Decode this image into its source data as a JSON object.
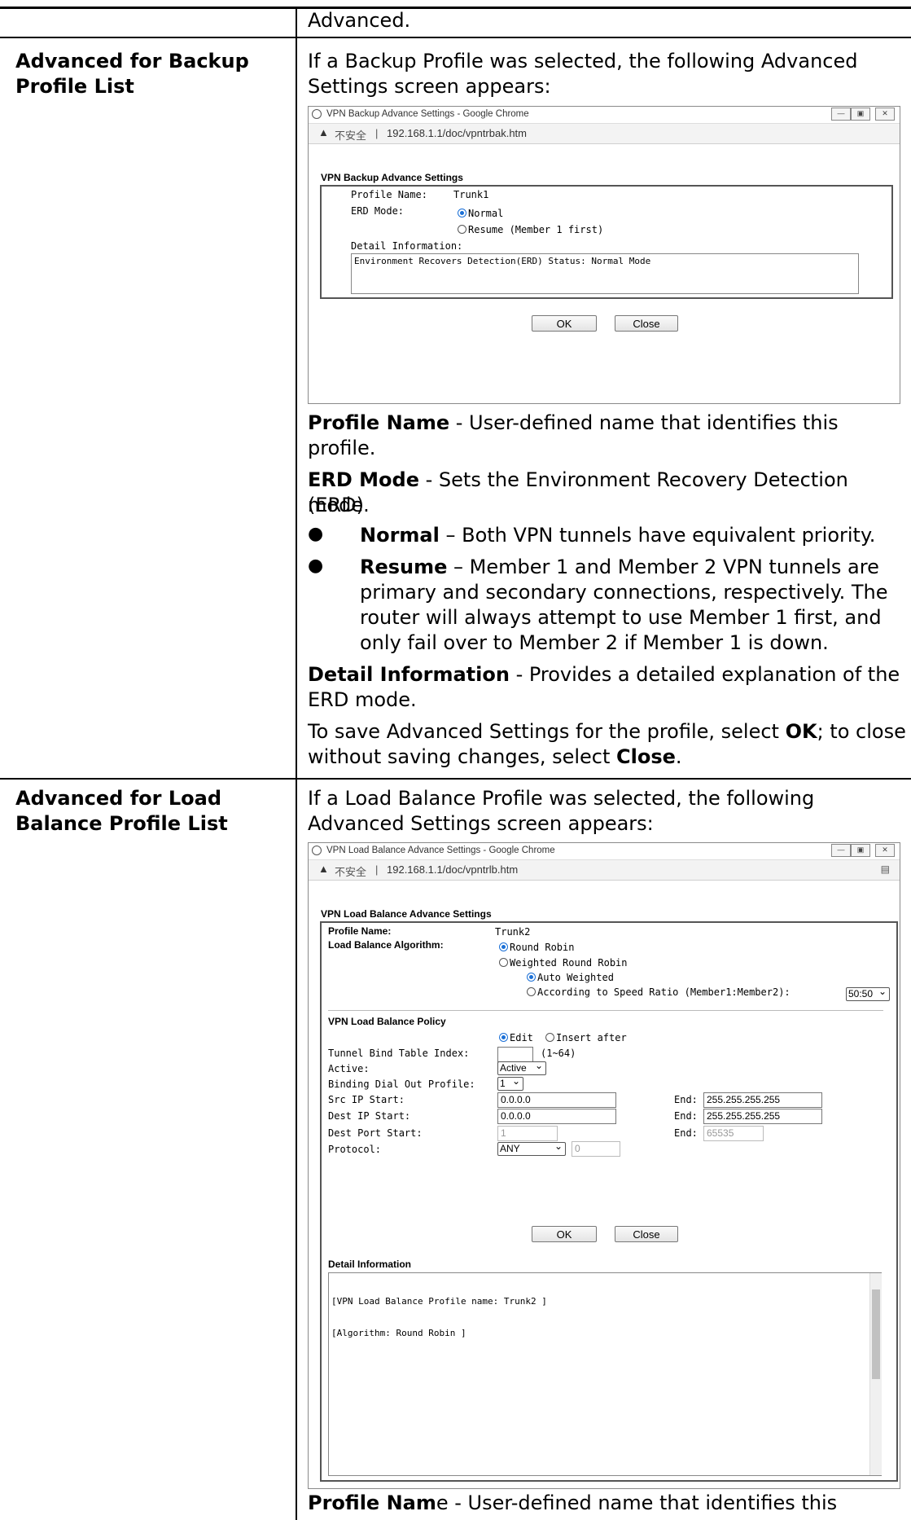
{
  "rows": {
    "top_text": "Advanced.",
    "backup": {
      "label_line1": "Advanced for Backup",
      "label_line2": "Profile List",
      "intro_line1": "If a Backup Profile was selected, the following Advanced",
      "intro_line2": "Settings screen appears:",
      "profile_name_term": "Profile Name",
      "profile_name_desc1": " - User-defined name that identifies this",
      "profile_name_desc2": "profile.",
      "erd_term": "ERD Mode",
      "erd_desc1": " - Sets the Environment Recovery Detection (ERD)",
      "erd_desc2": "mode.",
      "bullet_normal_term": "Normal",
      "bullet_normal_desc": " – Both VPN tunnels have equivalent priority.",
      "bullet_resume_term": "Resume",
      "bullet_resume_desc1": " – Member 1 and Member 2 VPN tunnels are",
      "bullet_resume_desc2": "primary and secondary connections, respectively. The",
      "bullet_resume_desc3": "router will always attempt to use Member 1 first, and",
      "bullet_resume_desc4": "only fail over to Member 2 if Member 1 is down.",
      "detail_term": "Detail Information",
      "detail_desc1": " - Provides a detailed explanation of the",
      "detail_desc2": "ERD mode.",
      "save_line1_a": "To save Advanced Settings for the profile, select ",
      "save_ok": "OK",
      "save_line1_b": "; to close",
      "save_line2_a": "without saving changes, select ",
      "save_close": "Close",
      "save_line2_b": "."
    },
    "lb": {
      "label_line1": "Advanced for Load",
      "label_line2": "Balance Profile List",
      "intro_line1": "If a Load Balance Profile was selected, the following",
      "intro_line2": "Advanced Settings screen appears:",
      "profile_name_term": "Profile Nam",
      "profile_name_e": "e",
      "profile_name_desc": " - User-defined name that identifies this"
    }
  },
  "bullet_glyph": "●",
  "win1": {
    "title": "VPN Backup Advance Settings - Google Chrome",
    "not_secure": "不安全",
    "url": "192.168.1.1/doc/vpntrbak.htm",
    "section_title": "VPN Backup Advance Settings",
    "profile_name_label": "Profile Name:",
    "profile_name_value": "Trunk1",
    "erd_label": "ERD Mode:",
    "erd_normal": "Normal",
    "erd_resume": "Resume (Member 1 first)",
    "detail_label": "Detail Information:",
    "detail_text": "Environment Recovers Detection(ERD) Status: Normal Mode",
    "ok": "OK",
    "close": "Close"
  },
  "win2": {
    "title": "VPN Load Balance Advance Settings - Google Chrome",
    "not_secure": "不安全",
    "url": "192.168.1.1/doc/vpntrlb.htm",
    "section_title": "VPN Load Balance Advance Settings",
    "profile_name_label": "Profile Name:",
    "profile_name_value": "Trunk2",
    "algo_label": "Load Balance Algorithm:",
    "algo_rr": "Round Robin",
    "algo_wrr": "Weighted Round Robin",
    "algo_auto": "Auto Weighted",
    "algo_ratio": "According to Speed Ratio (Member1:Member2):",
    "ratio_value": "50:50",
    "policy_title": "VPN Load Balance Policy",
    "edit": "Edit",
    "insert_after": "Insert after",
    "tbti_label": "Tunnel Bind Table Index:",
    "tbti_range": "(1~64)",
    "active_label": "Active:",
    "active_value": "Active",
    "bdop_label": "Binding Dial Out Profile:",
    "bdop_value": "1",
    "src_ip_label": "Src IP Start:",
    "src_ip_start": "0.0.0.0",
    "end_label": "End:",
    "src_ip_end": "255.255.255.255",
    "dest_ip_label": "Dest IP Start:",
    "dest_ip_start": "0.0.0.0",
    "dest_ip_end": "255.255.255.255",
    "dest_port_label": "Dest Port Start:",
    "dest_port_start": "1",
    "dest_port_end": "65535",
    "protocol_label": "Protocol:",
    "protocol_value": "ANY",
    "protocol_num": "0",
    "ok": "OK",
    "close": "Close",
    "detail_title": "Detail Information",
    "detail_line1": "[VPN Load Balance Profile name: Trunk2 ]",
    "detail_line2": "[Algorithm: Round Robin ]"
  }
}
